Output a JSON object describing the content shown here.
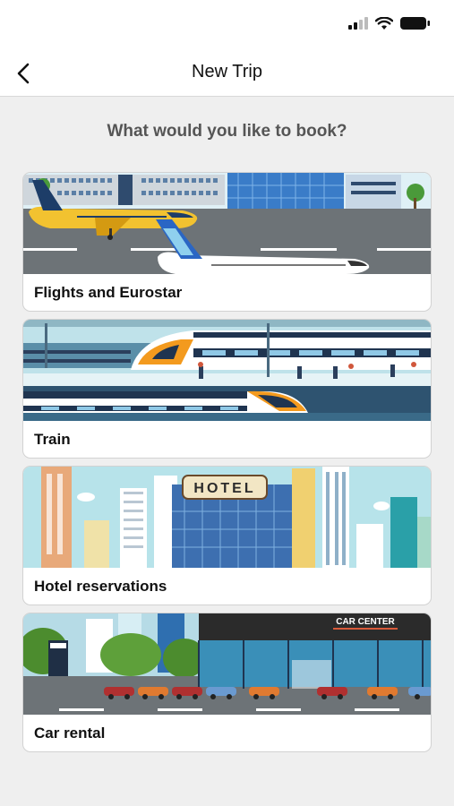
{
  "status": {
    "signal_icon": "signal-bars-icon",
    "wifi_icon": "wifi-icon",
    "battery_icon": "battery-icon"
  },
  "nav": {
    "back_icon": "chevron-left-icon",
    "title": "New Trip"
  },
  "prompt": "What would you like to book?",
  "options": [
    {
      "label": "Flights and Eurostar",
      "illustration": "airport-planes"
    },
    {
      "label": "Train",
      "illustration": "train-station"
    },
    {
      "label": "Hotel reservations",
      "illustration": "hotel-city",
      "sign": "HOTEL"
    },
    {
      "label": "Car rental",
      "illustration": "car-center",
      "sign": "CAR CENTER"
    }
  ],
  "colors": {
    "background": "#efefef",
    "header": "#ffffff",
    "card": "#ffffff",
    "prompt_text": "#555555"
  }
}
